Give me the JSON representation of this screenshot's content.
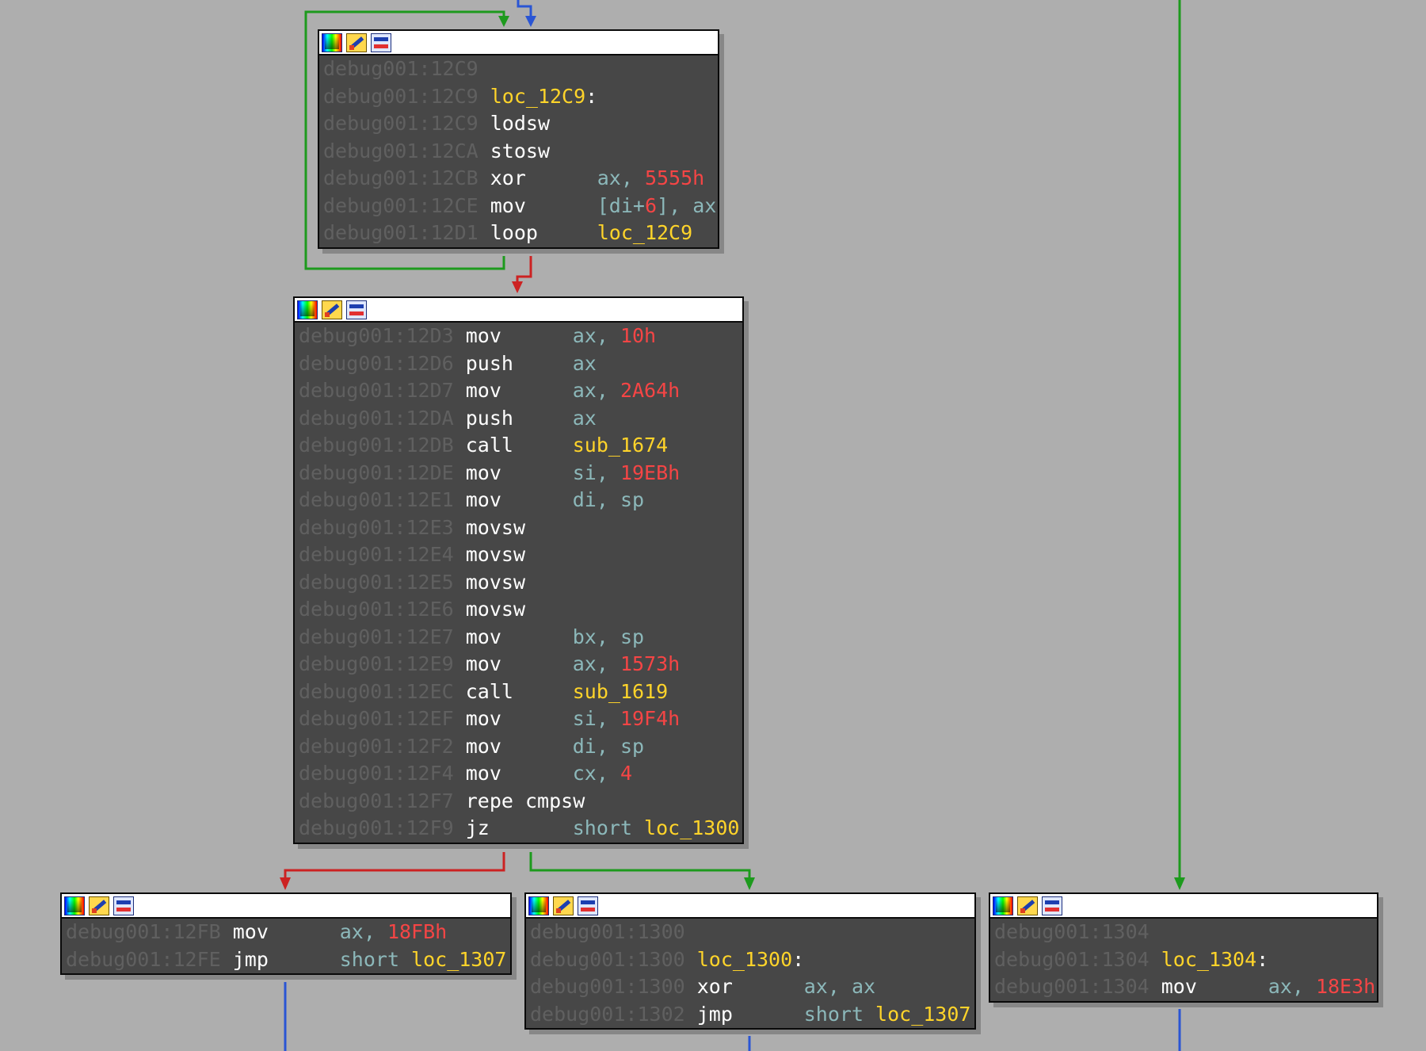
{
  "nodes": [
    {
      "id": "block-12c9",
      "lines": [
        {
          "addr": "debug001:12C9"
        },
        {
          "addr": "debug001:12C9",
          "label": "loc_12C9"
        },
        {
          "addr": "debug001:12C9",
          "mnem": "lodsw"
        },
        {
          "addr": "debug001:12CA",
          "mnem": "stosw"
        },
        {
          "addr": "debug001:12CB",
          "mnem": "xor",
          "ops": [
            {
              "t": "reg",
              "v": "ax"
            },
            {
              "t": "sep",
              "v": ", "
            },
            {
              "t": "num",
              "v": "5555h"
            }
          ]
        },
        {
          "addr": "debug001:12CE",
          "mnem": "mov",
          "ops": [
            {
              "t": "reg",
              "v": "[di+"
            },
            {
              "t": "num",
              "v": "6"
            },
            {
              "t": "reg",
              "v": "]"
            },
            {
              "t": "sep",
              "v": ", "
            },
            {
              "t": "reg",
              "v": "ax"
            }
          ]
        },
        {
          "addr": "debug001:12D1",
          "mnem": "loop",
          "ops": [
            {
              "t": "lbl",
              "v": "loc_12C9"
            }
          ]
        }
      ]
    },
    {
      "id": "block-12d3",
      "lines": [
        {
          "addr": "debug001:12D3",
          "mnem": "mov",
          "ops": [
            {
              "t": "reg",
              "v": "ax"
            },
            {
              "t": "sep",
              "v": ", "
            },
            {
              "t": "num",
              "v": "10h"
            }
          ]
        },
        {
          "addr": "debug001:12D6",
          "mnem": "push",
          "ops": [
            {
              "t": "reg",
              "v": "ax"
            }
          ]
        },
        {
          "addr": "debug001:12D7",
          "mnem": "mov",
          "ops": [
            {
              "t": "reg",
              "v": "ax"
            },
            {
              "t": "sep",
              "v": ", "
            },
            {
              "t": "num",
              "v": "2A64h"
            }
          ]
        },
        {
          "addr": "debug001:12DA",
          "mnem": "push",
          "ops": [
            {
              "t": "reg",
              "v": "ax"
            }
          ]
        },
        {
          "addr": "debug001:12DB",
          "mnem": "call",
          "ops": [
            {
              "t": "lbl",
              "v": "sub_1674"
            }
          ]
        },
        {
          "addr": "debug001:12DE",
          "mnem": "mov",
          "ops": [
            {
              "t": "reg",
              "v": "si"
            },
            {
              "t": "sep",
              "v": ", "
            },
            {
              "t": "num",
              "v": "19EBh"
            }
          ]
        },
        {
          "addr": "debug001:12E1",
          "mnem": "mov",
          "ops": [
            {
              "t": "reg",
              "v": "di"
            },
            {
              "t": "sep",
              "v": ", "
            },
            {
              "t": "reg",
              "v": "sp"
            }
          ]
        },
        {
          "addr": "debug001:12E3",
          "mnem": "movsw"
        },
        {
          "addr": "debug001:12E4",
          "mnem": "movsw"
        },
        {
          "addr": "debug001:12E5",
          "mnem": "movsw"
        },
        {
          "addr": "debug001:12E6",
          "mnem": "movsw"
        },
        {
          "addr": "debug001:12E7",
          "mnem": "mov",
          "ops": [
            {
              "t": "reg",
              "v": "bx"
            },
            {
              "t": "sep",
              "v": ", "
            },
            {
              "t": "reg",
              "v": "sp"
            }
          ]
        },
        {
          "addr": "debug001:12E9",
          "mnem": "mov",
          "ops": [
            {
              "t": "reg",
              "v": "ax"
            },
            {
              "t": "sep",
              "v": ", "
            },
            {
              "t": "num",
              "v": "1573h"
            }
          ]
        },
        {
          "addr": "debug001:12EC",
          "mnem": "call",
          "ops": [
            {
              "t": "lbl",
              "v": "sub_1619"
            }
          ]
        },
        {
          "addr": "debug001:12EF",
          "mnem": "mov",
          "ops": [
            {
              "t": "reg",
              "v": "si"
            },
            {
              "t": "sep",
              "v": ", "
            },
            {
              "t": "num",
              "v": "19F4h"
            }
          ]
        },
        {
          "addr": "debug001:12F2",
          "mnem": "mov",
          "ops": [
            {
              "t": "reg",
              "v": "di"
            },
            {
              "t": "sep",
              "v": ", "
            },
            {
              "t": "reg",
              "v": "sp"
            }
          ]
        },
        {
          "addr": "debug001:12F4",
          "mnem": "mov",
          "ops": [
            {
              "t": "reg",
              "v": "cx"
            },
            {
              "t": "sep",
              "v": ", "
            },
            {
              "t": "num",
              "v": "4"
            }
          ]
        },
        {
          "addr": "debug001:12F7",
          "mnem": "repe cmpsw"
        },
        {
          "addr": "debug001:12F9",
          "mnem": "jz",
          "ops": [
            {
              "t": "reg",
              "v": "short "
            },
            {
              "t": "lbl",
              "v": "loc_1300"
            }
          ]
        }
      ]
    },
    {
      "id": "block-12fb",
      "lines": [
        {
          "addr": "debug001:12FB",
          "mnem": "mov",
          "ops": [
            {
              "t": "reg",
              "v": "ax"
            },
            {
              "t": "sep",
              "v": ", "
            },
            {
              "t": "num",
              "v": "18FBh"
            }
          ]
        },
        {
          "addr": "debug001:12FE",
          "mnem": "jmp",
          "ops": [
            {
              "t": "reg",
              "v": "short "
            },
            {
              "t": "lbl",
              "v": "loc_1307"
            }
          ]
        }
      ]
    },
    {
      "id": "block-1300",
      "lines": [
        {
          "addr": "debug001:1300"
        },
        {
          "addr": "debug001:1300",
          "label": "loc_1300"
        },
        {
          "addr": "debug001:1300",
          "mnem": "xor",
          "ops": [
            {
              "t": "reg",
              "v": "ax"
            },
            {
              "t": "sep",
              "v": ", "
            },
            {
              "t": "reg",
              "v": "ax"
            }
          ]
        },
        {
          "addr": "debug001:1302",
          "mnem": "jmp",
          "ops": [
            {
              "t": "reg",
              "v": "short "
            },
            {
              "t": "lbl",
              "v": "loc_1307"
            }
          ]
        }
      ]
    },
    {
      "id": "block-1304",
      "lines": [
        {
          "addr": "debug001:1304"
        },
        {
          "addr": "debug001:1304",
          "label": "loc_1304"
        },
        {
          "addr": "debug001:1304",
          "mnem": "mov",
          "ops": [
            {
              "t": "reg",
              "v": "ax"
            },
            {
              "t": "sep",
              "v": ", "
            },
            {
              "t": "num",
              "v": "18E3h"
            }
          ]
        }
      ]
    }
  ],
  "edge_colors": {
    "true": "#1d9a1d",
    "false": "#cc2222",
    "normal": "#2a55d4",
    "back": "#1d9a1d"
  },
  "node_toolbar": {
    "icons": [
      "color-palette-icon",
      "edit-node-icon",
      "graph-overview-icon"
    ]
  }
}
